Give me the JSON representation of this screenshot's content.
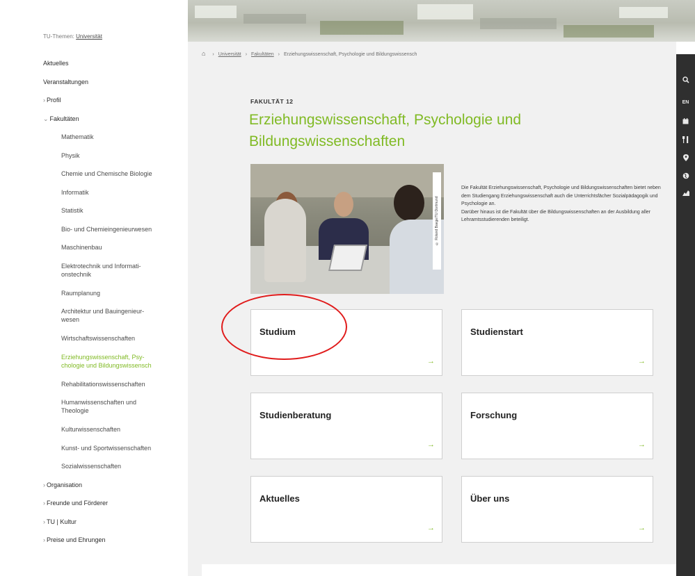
{
  "sidebar": {
    "topic_prefix": "TU-Themen:",
    "topic_link": "Universität",
    "items": [
      {
        "label": "Aktuelles",
        "level": "top"
      },
      {
        "label": "Veranstaltungen",
        "level": "top"
      },
      {
        "label": "Profil",
        "level": "top",
        "chevron": "›"
      },
      {
        "label": "Fakultäten",
        "level": "top",
        "chevron": "⌄"
      },
      {
        "label": "Mathematik",
        "level": "sub"
      },
      {
        "label": "Physik",
        "level": "sub"
      },
      {
        "label": "Chemie und Chemische Biologie",
        "level": "sub"
      },
      {
        "label": "Informatik",
        "level": "sub"
      },
      {
        "label": "Statistik",
        "level": "sub"
      },
      {
        "label": "Bio- und Chemieingenieurwesen",
        "level": "sub"
      },
      {
        "label": "Maschinenbau",
        "level": "sub"
      },
      {
        "label": "Elektrotechnik und Informati-",
        "label2": "onstechnik",
        "level": "sub"
      },
      {
        "label": "Raumplanung",
        "level": "sub"
      },
      {
        "label": "Architektur und Bauingenieur-",
        "label2": "wesen",
        "level": "sub"
      },
      {
        "label": "Wirtschaftswissenschaften",
        "level": "sub"
      },
      {
        "label": "Erziehungswissenschaft, Psy-",
        "label2": "chologie und Bildungswissensch",
        "level": "sub",
        "active": true
      },
      {
        "label": "Rehabilitationswissenschaften",
        "level": "sub"
      },
      {
        "label": "Humanwissenschaften und",
        "label2": "Theologie",
        "level": "sub"
      },
      {
        "label": "Kulturwissenschaften",
        "level": "sub"
      },
      {
        "label": "Kunst- und Sportwissenschaften",
        "level": "sub"
      },
      {
        "label": "Sozialwissenschaften",
        "level": "sub"
      },
      {
        "label": "Organisation",
        "level": "top",
        "chevron": "›"
      },
      {
        "label": "Freunde und Förderer",
        "level": "top",
        "chevron": "›"
      },
      {
        "label": "TU | Kultur",
        "level": "top",
        "chevron": "›"
      },
      {
        "label": "Preise und Ehrungen",
        "level": "top",
        "chevron": "›"
      }
    ]
  },
  "breadcrumb": {
    "home_icon": "home-icon",
    "items": [
      "Universität",
      "Fakultäten",
      "Erziehungswissenschaft, Psychologie und Bildungswissensch"
    ]
  },
  "page": {
    "kicker": "FAKULTÄT 12",
    "title": "Erziehungswissenschaft, Psychologie und Bildungswissenschaften",
    "photo_credit": "© Roland Baege/TU Dortmund",
    "description_1": "Die Fakultät Erziehungswissenschaft, Psychologie und Bildungswissenschaften bietet neben dem Studiengang Erziehungswissenschaft auch die Unterrichtsfächer Sozialpädagogik und Psychologie an.",
    "description_2": "Darüber hinaus ist die Fakultät über die Bildungswissenschaften an der Ausbildung aller Lehramtsstudierenden beteiligt."
  },
  "cards": [
    {
      "label": "Studium",
      "arrow": "→"
    },
    {
      "label": "Studienstart",
      "arrow": "→"
    },
    {
      "label": "Studienberatung",
      "arrow": "→"
    },
    {
      "label": "Forschung",
      "arrow": "→"
    },
    {
      "label": "Aktuelles",
      "arrow": "→"
    },
    {
      "label": "Über uns",
      "arrow": "→"
    }
  ],
  "toolbar": {
    "icons": [
      "search-icon",
      "language-switch",
      "calendar-icon",
      "restaurant-icon",
      "location-icon",
      "globe-icon",
      "map-icon"
    ],
    "language_label": "EN"
  },
  "colors": {
    "accent": "#80ba24",
    "annotation": "#e01b1b",
    "toolbar_bg": "#2f2f2f",
    "content_bg": "#f1f1f1"
  }
}
